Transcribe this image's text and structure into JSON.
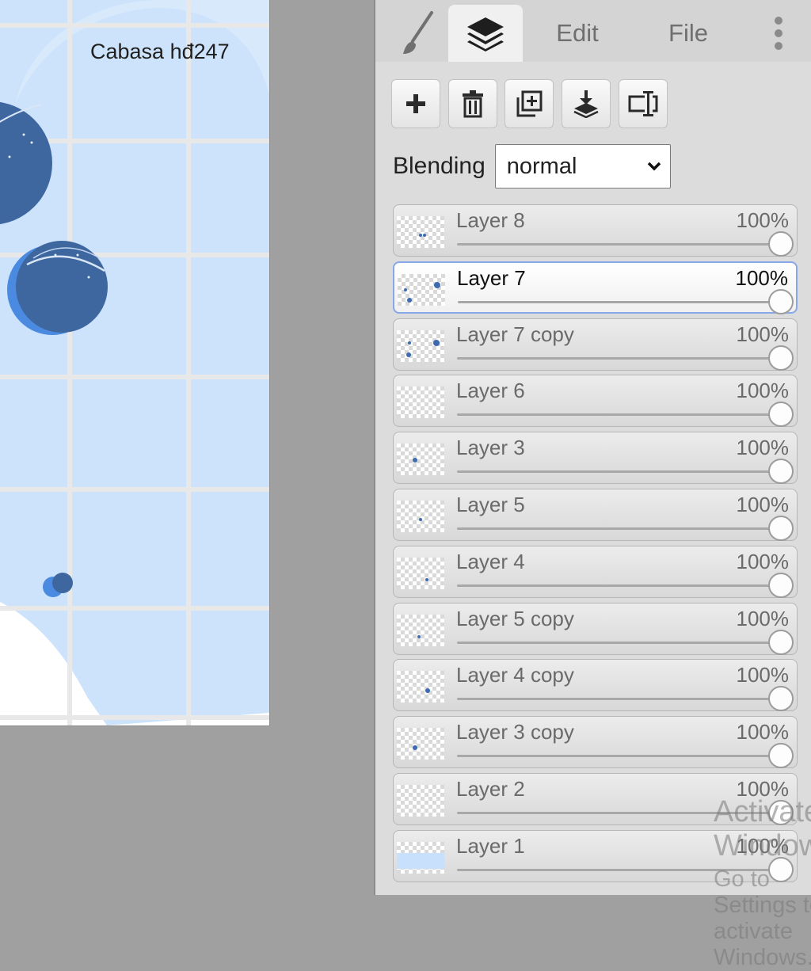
{
  "canvas": {
    "signature": "Cabasa hđ247",
    "colors": {
      "background_blob": "#c8e0fb",
      "grid": "#e7e7e7",
      "planet_dark": "#3f6aa7",
      "planet_accent": "#4a8ae0"
    }
  },
  "tabs": [
    {
      "id": "brush",
      "icon": "brush-icon",
      "label": ""
    },
    {
      "id": "layers",
      "icon": "layers-icon",
      "label": "",
      "active": true
    },
    {
      "id": "edit",
      "label": "Edit"
    },
    {
      "id": "file",
      "label": "File"
    },
    {
      "id": "more",
      "icon": "more-vertical-icon",
      "label": ""
    }
  ],
  "toolbar": [
    {
      "name": "add-layer",
      "icon": "plus-icon"
    },
    {
      "name": "delete-layer",
      "icon": "trash-icon"
    },
    {
      "name": "duplicate-layer",
      "icon": "duplicate-icon"
    },
    {
      "name": "merge-down",
      "icon": "merge-down-icon"
    },
    {
      "name": "rename-layer",
      "icon": "rename-icon"
    }
  ],
  "blending": {
    "label": "Blending",
    "value": "normal"
  },
  "layers": [
    {
      "name": "Layer 8",
      "opacity": "100%",
      "selected": false
    },
    {
      "name": "Layer 7",
      "opacity": "100%",
      "selected": true
    },
    {
      "name": "Layer 7 copy",
      "opacity": "100%",
      "selected": false
    },
    {
      "name": "Layer 6",
      "opacity": "100%",
      "selected": false
    },
    {
      "name": "Layer 3",
      "opacity": "100%",
      "selected": false
    },
    {
      "name": "Layer 5",
      "opacity": "100%",
      "selected": false
    },
    {
      "name": "Layer 4",
      "opacity": "100%",
      "selected": false
    },
    {
      "name": "Layer 5 copy",
      "opacity": "100%",
      "selected": false
    },
    {
      "name": "Layer 4 copy",
      "opacity": "100%",
      "selected": false
    },
    {
      "name": "Layer 3 copy",
      "opacity": "100%",
      "selected": false
    },
    {
      "name": "Layer 2",
      "opacity": "100%",
      "selected": false
    },
    {
      "name": "Layer 1",
      "opacity": "100%",
      "selected": false
    }
  ],
  "watermark": {
    "title": "Activate Windows",
    "subtitle": "Go to Settings to activate Windows."
  }
}
